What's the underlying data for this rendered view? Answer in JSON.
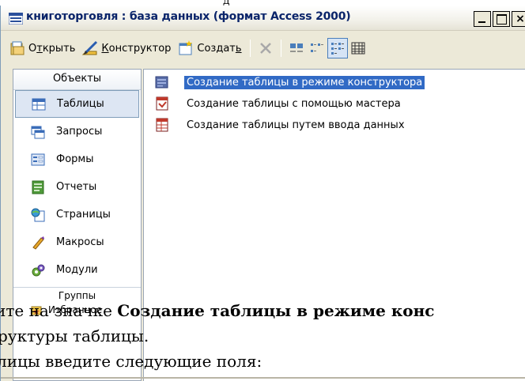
{
  "window": {
    "title": "книготорговля : база данных (формат Access 2000)",
    "close_glyph": "×"
  },
  "toolbar": {
    "open": {
      "prefix": "О",
      "mnemonic": "т",
      "rest": "крыть"
    },
    "design": {
      "mnemonic": "К",
      "rest": "онструктор"
    },
    "create": {
      "text": "Создат",
      "mnemonic": "ь"
    }
  },
  "objects_pane": {
    "header": "Объекты",
    "items": [
      {
        "label": "Таблицы",
        "icon": "table-icon",
        "selected": true
      },
      {
        "label": "Запросы",
        "icon": "query-icon"
      },
      {
        "label": "Формы",
        "icon": "form-icon"
      },
      {
        "label": "Отчеты",
        "icon": "report-icon"
      },
      {
        "label": "Страницы",
        "icon": "page-icon"
      },
      {
        "label": "Макросы",
        "icon": "macro-icon"
      },
      {
        "label": "Модули",
        "icon": "module-icon"
      }
    ],
    "groups_header": "Группы",
    "favorites": "Избранное"
  },
  "content_pane": {
    "items": [
      {
        "label": "Создание таблицы в режиме конструктора",
        "icon": "design-view-icon",
        "selected": true
      },
      {
        "label": "Создание таблицы с помощью мастера",
        "icon": "wizard-icon"
      },
      {
        "label": "Создание таблицы путем ввода данных",
        "icon": "datasheet-icon"
      }
    ]
  },
  "document_overlay": {
    "line1_prefix": "ите на значке ",
    "line1_bold": "Создание таблицы в режиме конс",
    "line2": "руктуры таблицы.",
    "line3": "лицы введите следующие поля:",
    "top_fragment": "д"
  },
  "colors": {
    "title_text": "#0a246a",
    "selection": "#316ac5",
    "pane_selected": "#dde6f3"
  }
}
